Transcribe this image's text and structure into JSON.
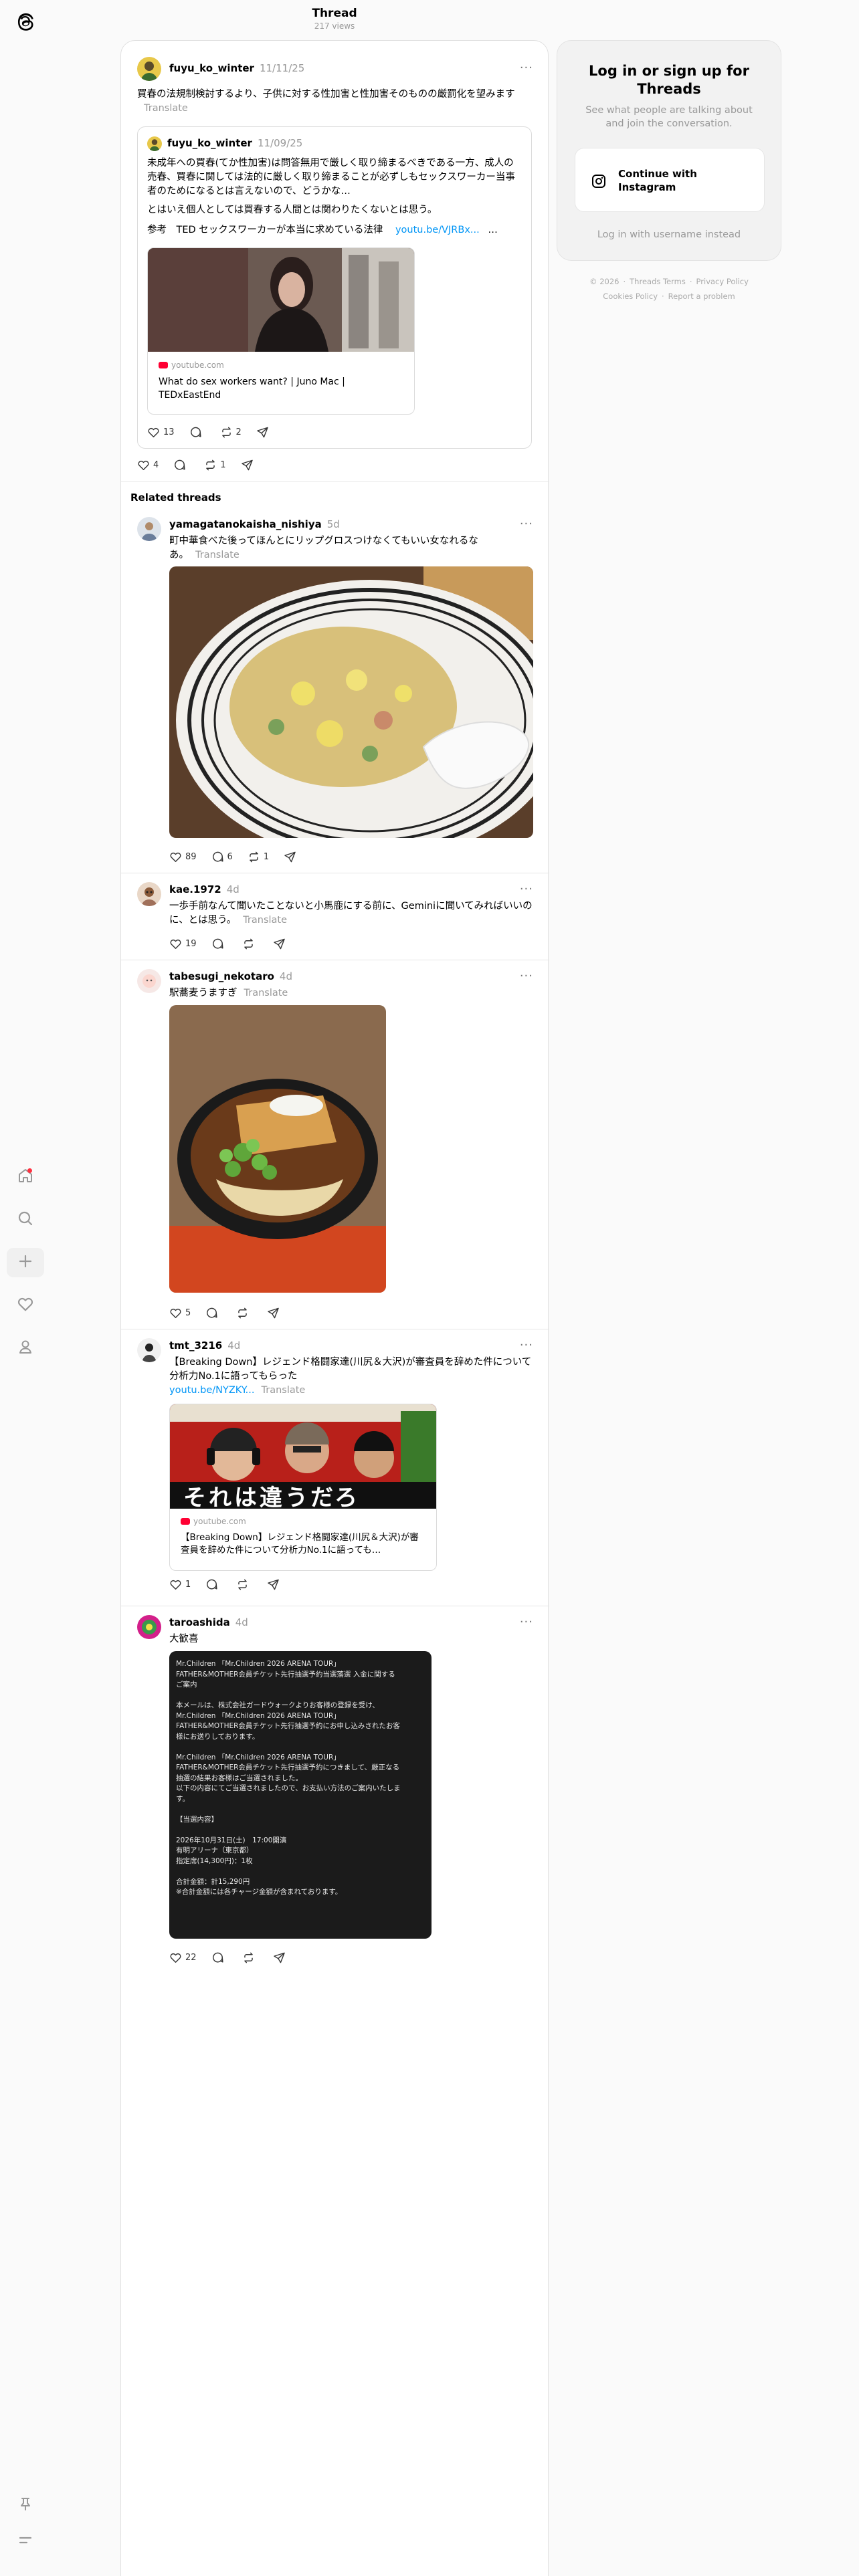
{
  "header": {
    "title": "Thread",
    "views": "217 views"
  },
  "main_post": {
    "username": "fuyu_ko_winter",
    "date": "11/11/25",
    "text": "買春の法規制検討するより、子供に対する性加害と性加害そのものの厳罰化を望みます",
    "translate": "Translate",
    "likes": "4",
    "reposts": "1"
  },
  "quoted_post": {
    "username": "fuyu_ko_winter",
    "date": "11/09/25",
    "text": "未成年への買春(てか性加害)は問答無用で厳しく取り締まるべきである一方、成人の売春、買春に関しては法的に厳しく取り締まることが必ずしもセックスワーカー当事者のためになるとは言えないので、どうかな…",
    "text2": "とはいえ個人としては買春する人間とは関わりたくないとは思う。",
    "ref_label": "参考　TED セックスワーカーが本当に求めている法律",
    "ref_link": "youtu.be/VJRBx...",
    "ref_more": "…",
    "card_domain": "youtube.com",
    "card_title": "What do sex workers want? | Juno Mac | TEDxEastEnd",
    "likes": "13",
    "reposts": "2"
  },
  "related_heading": "Related threads",
  "related": [
    {
      "username": "yamagatanokaisha_nishiya",
      "age": "5d",
      "text": "町中華食べた後ってほんとにリップグロスつけなくてもいい女なれるな",
      "text_end": "あ。",
      "translate": "Translate",
      "likes": "89",
      "replies": "6",
      "reposts": "1"
    },
    {
      "username": "kae.1972",
      "age": "4d",
      "text": "一歩手前なんて聞いたことないと小馬鹿にする前に、Geminiに聞いてみればいいのに、とは思う。",
      "translate": "Translate",
      "likes": "19"
    },
    {
      "username": "tabesugi_nekotaro",
      "age": "4d",
      "text": "駅蕎麦うますぎ",
      "translate": "Translate",
      "likes": "5"
    },
    {
      "username": "tmt_3216",
      "age": "4d",
      "text": "【Breaking Down】レジェンド格闘家達(川尻＆大沢)が審査員を辞めた件について分析力No.1に語ってもらった",
      "link": "youtu.be/NYZKY...",
      "translate": "Translate",
      "card_domain": "youtube.com",
      "card_title": "【Breaking Down】レジェンド格闘家達(川尻＆大沢)が審査員を辞めた件について分析力No.1に語っても…",
      "thumb_caption": "それは違うだろ",
      "likes": "1"
    },
    {
      "username": "taroashida",
      "age": "4d",
      "text": "大歓喜",
      "likes": "22",
      "email_lines": [
        "Mr.Children 「Mr.Children 2026 ARENA TOUR」",
        "FATHER&MOTHER会員チケット先行抽選予約当選落選 入金に関する",
        "ご案内",
        "",
        "本メールは、株式会社ガードウォークよりお客様の登録を受け、",
        "Mr.Children 「Mr.Children 2026 ARENA TOUR」",
        "FATHER&MOTHER会員チケット先行抽選予約にお申し込みされたお客",
        "様にお送りしております。",
        "",
        "Mr.Children 「Mr.Children 2026 ARENA TOUR」",
        "FATHER&MOTHER会員チケット先行抽選予約につきまして、厳正なる",
        "抽選の結果お客様はご当選されました。",
        "以下の内容にてご当選されましたので、お支払い方法のご案内いたしま",
        "す。",
        "",
        "【当選内容】",
        "",
        "2026年10月31日(土)　17:00開演",
        "有明アリーナ（東京都）",
        "指定席(14,300円)：1枚",
        "",
        "合計金額：計15,290円",
        "※合計金額には各チャージ金額が含まれております。"
      ]
    }
  ],
  "login_panel": {
    "title": "Log in or sign up for Threads",
    "subtitle": "See what people are talking about and join the conversation.",
    "button": "Continue with Instagram",
    "alt": "Log in with username instead"
  },
  "footer": {
    "copyright": "© 2026",
    "terms": "Threads Terms",
    "privacy": "Privacy Policy",
    "cookies": "Cookies Policy",
    "report": "Report a problem"
  },
  "icons": [
    "threads-logo-icon",
    "home-icon",
    "search-icon",
    "plus-icon",
    "heart-icon",
    "profile-icon",
    "pin-icon",
    "menu-icon",
    "reply-icon",
    "repost-icon",
    "share-icon",
    "more-icon",
    "instagram-icon"
  ],
  "colors": {
    "link": "#0095f6",
    "notification": "#ff3040",
    "youtube": "#ff0033"
  }
}
